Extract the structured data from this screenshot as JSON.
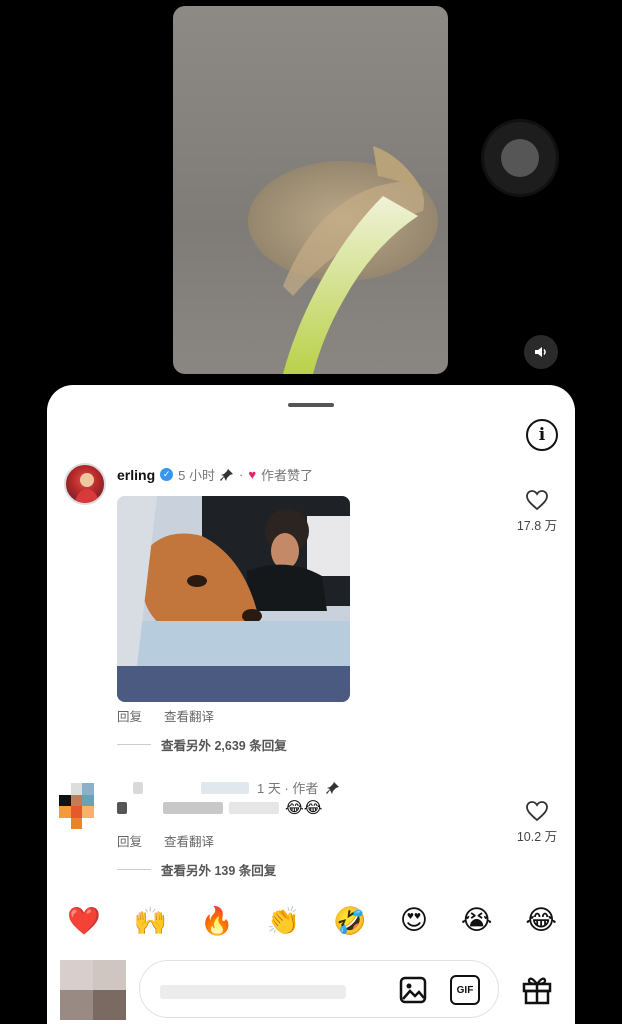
{
  "comments": [
    {
      "username": "erling",
      "time": "5 小时",
      "separator": "·",
      "author_liked": "作者赞了",
      "like_count": "17.8 万",
      "reply_label": "回复",
      "translate_label": "查看翻译",
      "more_replies": "查看另外 2,639 条回复"
    },
    {
      "time_partial": "1 天 · 作者",
      "emojis": "😂😂",
      "like_count": "10.2 万",
      "reply_label": "回复",
      "translate_label": "查看翻译",
      "more_replies": "查看另外 139 条回复"
    }
  ],
  "quick_emojis": [
    "❤️",
    "🙌",
    "🔥",
    "👏",
    "🤣",
    "😍",
    "😭",
    "😂"
  ],
  "icons": {
    "info": "i",
    "gif": "GIF"
  },
  "colors": {
    "verified": "#3797f0",
    "heart": "#e0245e"
  }
}
